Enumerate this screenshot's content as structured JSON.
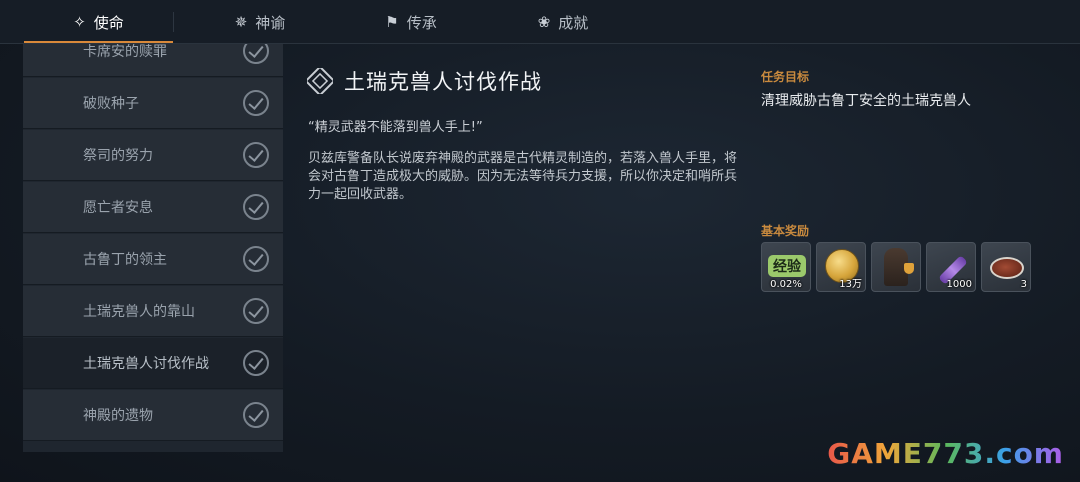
{
  "tabs": [
    {
      "label": "使命",
      "icon": "torch-icon",
      "active": true
    },
    {
      "label": "神谕",
      "icon": "star-icon",
      "active": false
    },
    {
      "label": "传承",
      "icon": "flag-icon",
      "active": false
    },
    {
      "label": "成就",
      "icon": "medal-icon",
      "active": false
    }
  ],
  "missions": [
    {
      "label": "卡席安的赎罪",
      "completed": true
    },
    {
      "label": "破败种子",
      "completed": true
    },
    {
      "label": "祭司的努力",
      "completed": true
    },
    {
      "label": "愿亡者安息",
      "completed": true
    },
    {
      "label": "古鲁丁的领主",
      "completed": true
    },
    {
      "label": "土瑞克兽人的靠山",
      "completed": true
    },
    {
      "label": "土瑞克兽人讨伐作战",
      "completed": true,
      "selected": true
    },
    {
      "label": "神殿的遗物",
      "completed": true
    }
  ],
  "detail": {
    "title": "土瑞克兽人讨伐作战",
    "quote": "“精灵武器不能落到兽人手上!”",
    "description": "贝兹库警备队长说废弃神殿的武器是古代精灵制造的，若落入兽人手里，将会对古鲁丁造成极大的威胁。因为无法等待兵力支援，所以你决定和哨所兵力一起回收武器。"
  },
  "objective": {
    "label": "任务目标",
    "text": "清理威胁古鲁丁安全的土瑞克兽人"
  },
  "rewards": {
    "label": "基本奖励",
    "items": [
      {
        "name": "exp-reward",
        "badge": "经验",
        "qty": "0.02%"
      },
      {
        "name": "gold-coin-reward",
        "qty": "13万"
      },
      {
        "name": "cloak-reward",
        "qty": ""
      },
      {
        "name": "scroll-reward",
        "qty": "1000"
      },
      {
        "name": "steak-reward",
        "qty": "3"
      }
    ]
  },
  "watermark": "GAME773.com",
  "colors": {
    "accent": "#d9893a",
    "section_label": "#c98a3e"
  }
}
